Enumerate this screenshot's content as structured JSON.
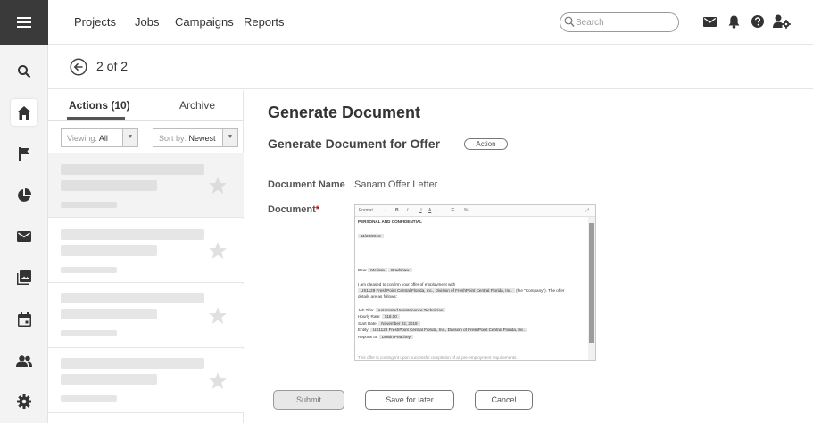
{
  "nav": {
    "projects": "Projects",
    "jobs": "Jobs",
    "campaigns": "Campaigns",
    "reports": "Reports"
  },
  "search": {
    "placeholder": "Search"
  },
  "icons": {
    "rail": [
      "menu-icon",
      "search-icon",
      "home-icon",
      "flag-icon",
      "pie-chart-icon",
      "mail-icon",
      "gallery-icon",
      "calendar-icon",
      "people-icon",
      "gear-icon"
    ],
    "top": [
      "mail-icon",
      "bell-icon",
      "help-icon",
      "user-settings-icon"
    ]
  },
  "pager": {
    "label": "2 of 2"
  },
  "tabs": {
    "actions": "Actions (10)",
    "archive": "Archive"
  },
  "filters": {
    "viewing_label": "Viewing: ",
    "viewing_value": "All",
    "sort_label": "Sort by: ",
    "sort_value": "Newest"
  },
  "main": {
    "title": "Generate Document",
    "subtitle": "Generate Document for Offer",
    "badge": "Action",
    "doc_name_label": "Document Name",
    "doc_name_value": "Sanam Offer Letter",
    "document_label": "Document",
    "required_mark": "*"
  },
  "editor": {
    "toolbar": {
      "format": "Format",
      "bold": "B",
      "italic": "I",
      "underline": "U",
      "color": "A"
    },
    "lines": {
      "heading": "PERSONAL AND CONFIDENTIAL",
      "date": "11/23/2019",
      "dear": "Dear",
      "first_name": "Melissa",
      "last_name": "Bradshaw",
      "intro": "I am pleased to confirm your offer of employment with",
      "company": "US1129 FreshPoint Central Florida, Inc., Division of FreshPoint Central Florida, Inc.",
      "company_suffix": "(the \"Company\"). The offer",
      "details": "details are as follows:",
      "job_title_label": "Job Title:",
      "job_title": "Automated Maintenance Technician",
      "hourly_label": "Hourly Rate:",
      "hourly": "$18.00",
      "start_label": "Start Date:",
      "start": "November 22, 2019",
      "entity_label": "Entity:",
      "entity": "US1129 FreshPoint Central Florida, Inc., Division of FreshPoint Central Florida, Inc.",
      "reports_label": "Reports to:",
      "reports": "Dustin Peachey",
      "cutoff": "This offer is contingent upon successful completion of all pre-employment requirements"
    }
  },
  "buttons": {
    "submit": "Submit",
    "save": "Save for later",
    "cancel": "Cancel"
  }
}
